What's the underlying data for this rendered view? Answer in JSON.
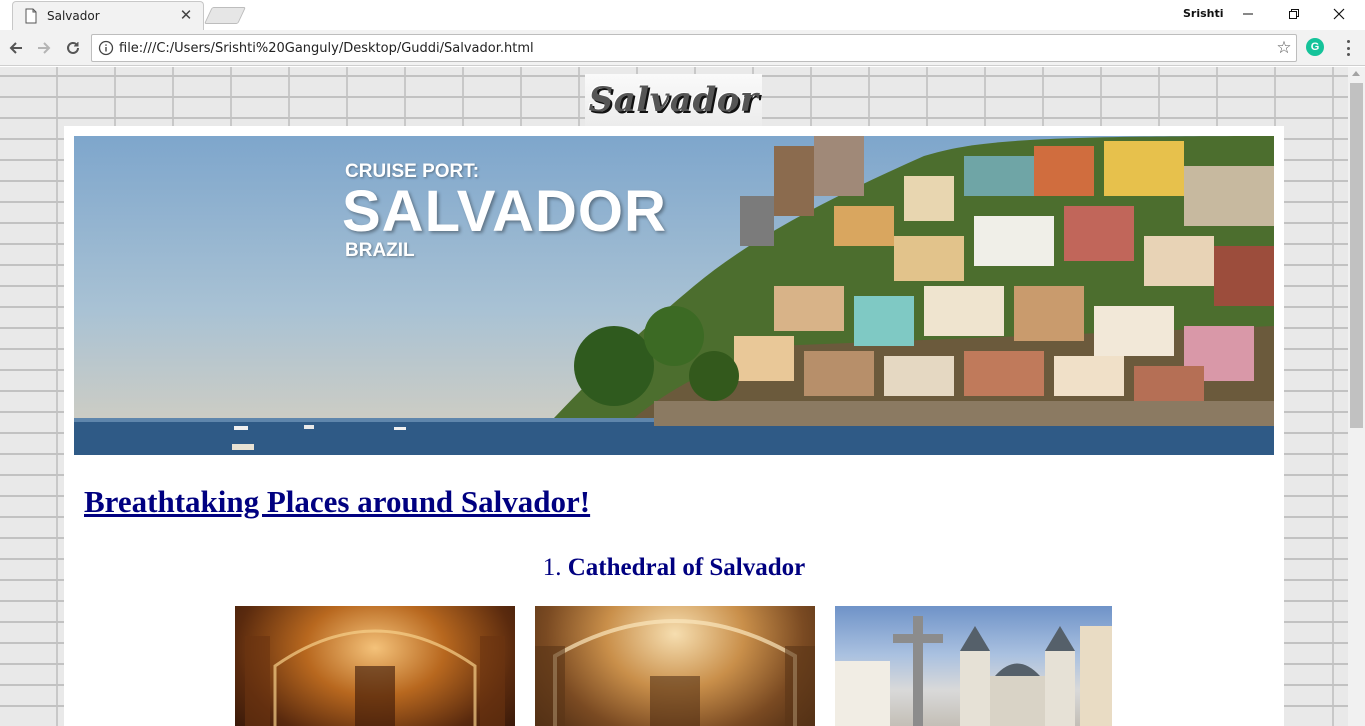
{
  "browser": {
    "tab_title": "Salvador",
    "profile_name": "Srishti",
    "url": "file:///C:/Users/Srishti%20Ganguly/Desktop/Guddi/Salvador.html",
    "icons": [
      "document-icon",
      "close-icon",
      "back-icon",
      "forward-icon",
      "reload-icon",
      "info-icon",
      "star-icon",
      "grammarly-icon",
      "menu-icon",
      "minimize-icon",
      "maximize-icon",
      "window-close-icon"
    ]
  },
  "page": {
    "logo_text": "Salvador",
    "banner": {
      "kicker": "CRUISE PORT:",
      "title": "SALVADOR",
      "subtitle": "BRAZIL"
    },
    "heading": "Breathtaking Places around Salvador!",
    "places": [
      {
        "number": "1.",
        "name": "Cathedral of Salvador"
      }
    ],
    "colors": {
      "heading": "#000080",
      "banner_text": "#ffffff"
    }
  }
}
